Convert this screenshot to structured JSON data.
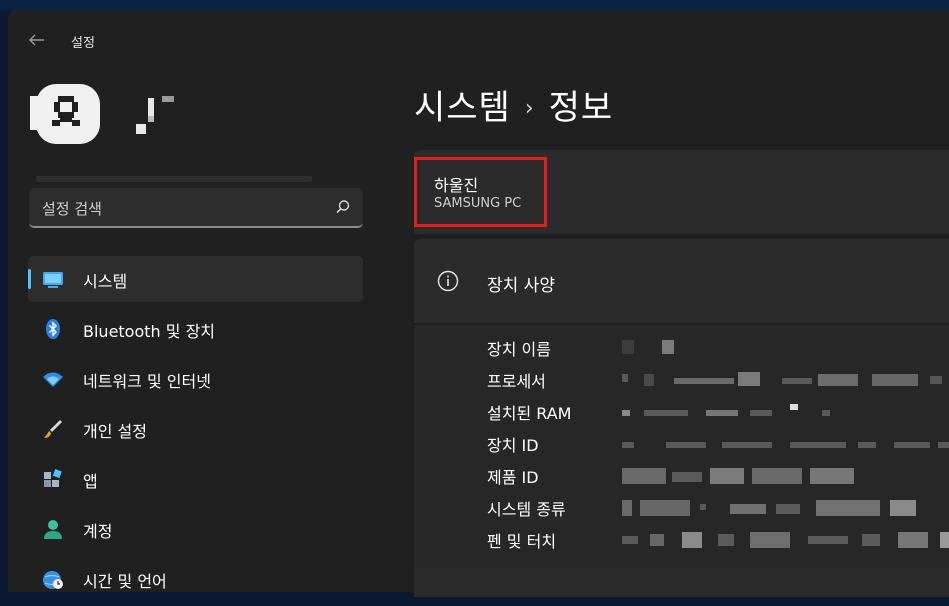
{
  "window": {
    "app_title": "설정"
  },
  "search": {
    "placeholder": "설정 검색"
  },
  "nav": {
    "items": [
      {
        "label": "시스템",
        "icon": "system-monitor-icon",
        "active": true,
        "color": "#4cc2ff"
      },
      {
        "label": "Bluetooth 및 장치",
        "icon": "bluetooth-icon",
        "color": "#3a8ee6"
      },
      {
        "label": "네트워크 및 인터넷",
        "icon": "wifi-icon",
        "color": "#55b7ff"
      },
      {
        "label": "개인 설정",
        "icon": "brush-icon",
        "color": "#f0a030"
      },
      {
        "label": "앱",
        "icon": "apps-icon",
        "color": "#a8b4c8"
      },
      {
        "label": "계정",
        "icon": "account-icon",
        "color": "#38c0a0"
      },
      {
        "label": "시간 및 언어",
        "icon": "globe-clock-icon",
        "color": "#4ca8e8"
      }
    ]
  },
  "breadcrumb": {
    "parent": "시스템",
    "separator": "›",
    "current": "정보"
  },
  "device": {
    "name": "하울진",
    "model": "SAMSUNG PC"
  },
  "specs": {
    "title": "장치 사양",
    "rows": [
      {
        "label": "장치 이름"
      },
      {
        "label": "프로세서"
      },
      {
        "label": "설치된 RAM"
      },
      {
        "label": "장치 ID"
      },
      {
        "label": "제품 ID"
      },
      {
        "label": "시스템 종류"
      },
      {
        "label": "펜 및 터치"
      }
    ]
  },
  "colors": {
    "accent": "#4cc2ff",
    "highlight_box": "#e02020"
  }
}
